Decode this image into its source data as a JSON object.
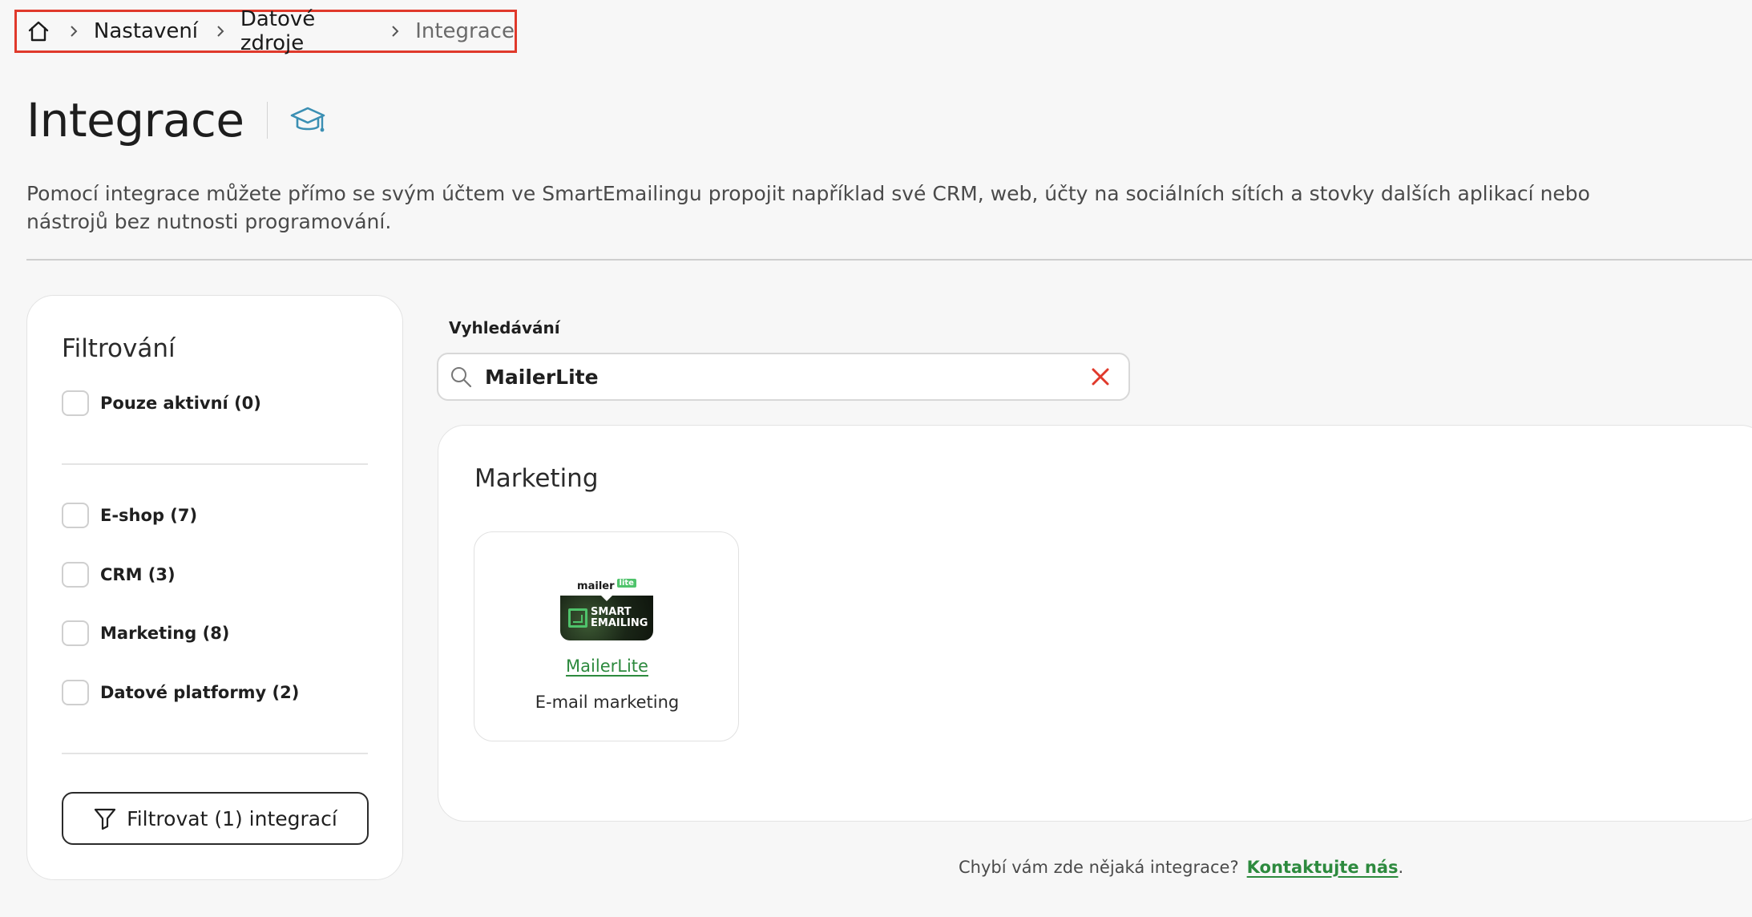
{
  "breadcrumb": {
    "home_icon": "home-icon",
    "items": [
      "Nastavení",
      "Datové zdroje"
    ],
    "current": "Integrace"
  },
  "page": {
    "title": "Integrace",
    "help_icon": "graduation-cap-icon",
    "description": "Pomocí integrace můžete přímo se svým účtem ve SmartEmailingu propojit například své CRM, web, účty na sociálních sítích a stovky dalších aplikací nebo nástrojů bez nutnosti programování."
  },
  "filter": {
    "title": "Filtrování",
    "only_active": "Pouze aktivní (0)",
    "categories": [
      "E-shop (7)",
      "CRM (3)",
      "Marketing (8)",
      "Datové platformy (2)"
    ],
    "button_label": "Filtrovat (1) integrací",
    "button_icon": "funnel-icon"
  },
  "search": {
    "label": "Vyhledávání",
    "value": "MailerLite",
    "search_icon": "search-icon",
    "clear_icon": "close-icon"
  },
  "results": {
    "section_title": "Marketing",
    "card": {
      "logo_top": "mailer",
      "logo_badge": "lite",
      "logo_line1": "SMART",
      "logo_line2": "EMAILING",
      "name": "MailerLite",
      "description": "E-mail marketing"
    }
  },
  "footer": {
    "text": "Chybí vám zde nějaká integrace?",
    "link": "Kontaktujte nás",
    "suffix": "."
  },
  "colors": {
    "accent_green": "#2d8a3e",
    "highlight_red": "#e0392b",
    "help_icon_blue": "#3b8fb3"
  }
}
